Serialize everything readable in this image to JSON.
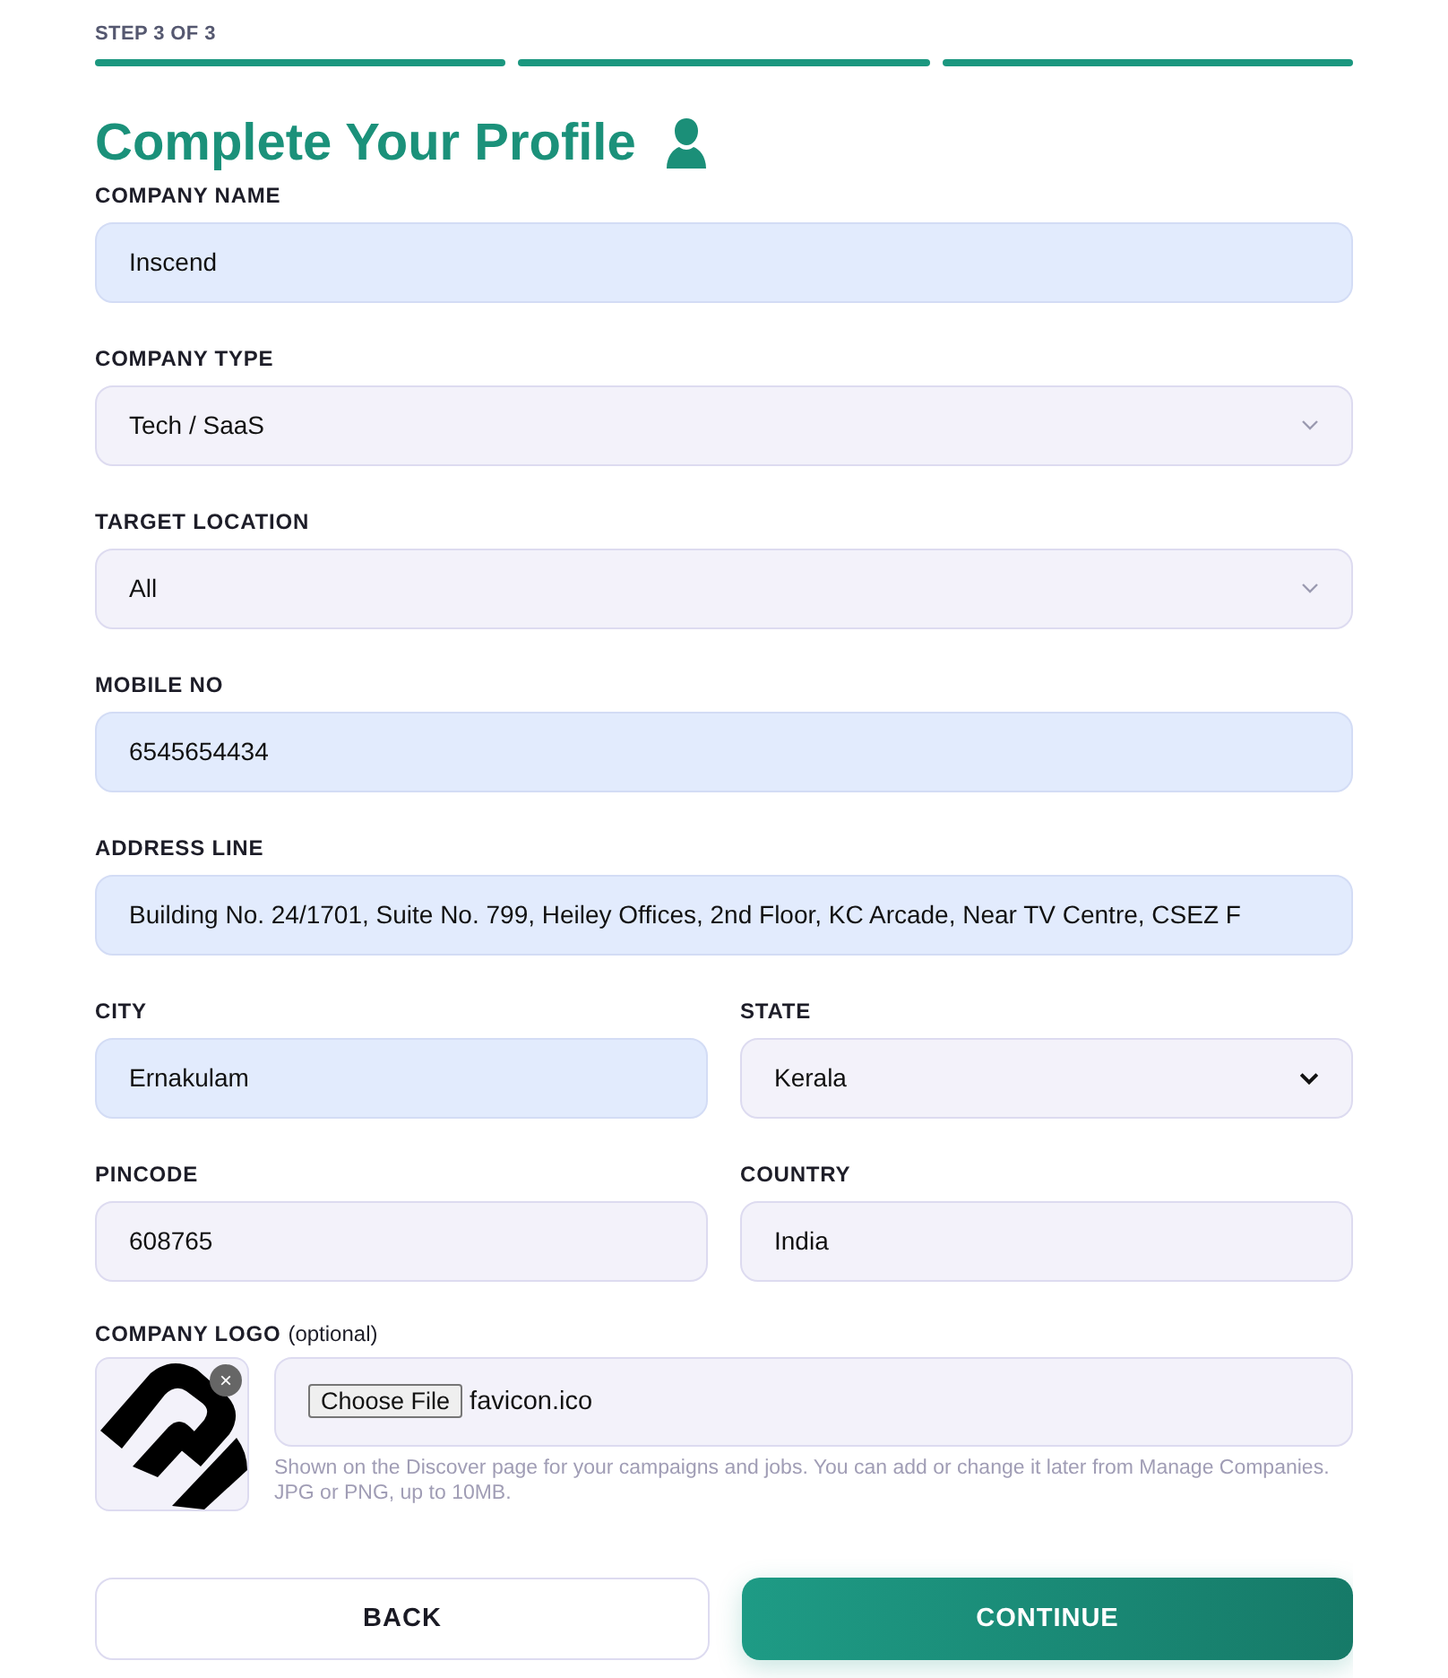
{
  "stepper": {
    "label": "STEP 3 OF 3",
    "steps": [
      {
        "done": true
      },
      {
        "done": true
      },
      {
        "done": true
      }
    ]
  },
  "title": "Complete Your Profile",
  "rows": [
    [
      {
        "label": "COMPANY NAME",
        "kind": "text",
        "value": "Inscend",
        "autofilled": true
      }
    ],
    [
      {
        "label": "COMPANY TYPE",
        "kind": "dropdown",
        "value": "Tech / SaaS",
        "autofilled": false
      }
    ],
    [
      {
        "label": "TARGET LOCATION",
        "kind": "dropdown",
        "value": "All",
        "autofilled": false
      }
    ],
    [
      {
        "label": "MOBILE NO",
        "kind": "text",
        "value": "6545654434",
        "autofilled": true
      }
    ],
    [
      {
        "label": "ADDRESS LINE",
        "kind": "text",
        "value": "Building No. 24/1701, Suite No. 799, Heiley Offices, 2nd Floor, KC Arcade, Near TV Centre, CSEZ F",
        "autofilled": true
      }
    ],
    [
      {
        "label": "CITY",
        "kind": "text",
        "value": "Ernakulam",
        "autofilled": true
      },
      {
        "label": "STATE",
        "kind": "native-select",
        "value": "Kerala",
        "autofilled": false
      }
    ],
    [
      {
        "label": "PINCODE",
        "kind": "text",
        "value": "608765",
        "autofilled": false
      },
      {
        "label": "COUNTRY",
        "kind": "text",
        "value": "India",
        "autofilled": false
      }
    ]
  ],
  "logo": {
    "label": "COMPANY LOGO",
    "note": "(optional)",
    "remove": "×",
    "button": "Choose File",
    "file": "favicon.ico",
    "help": "Shown on the Discover page for your campaigns and jobs. You can add or change it later from Manage Companies. JPG or PNG, up to 10MB."
  },
  "buttons": [
    {
      "label": "BACK",
      "kind": "secondary"
    },
    {
      "label": "CONTINUE",
      "kind": "primary"
    }
  ]
}
